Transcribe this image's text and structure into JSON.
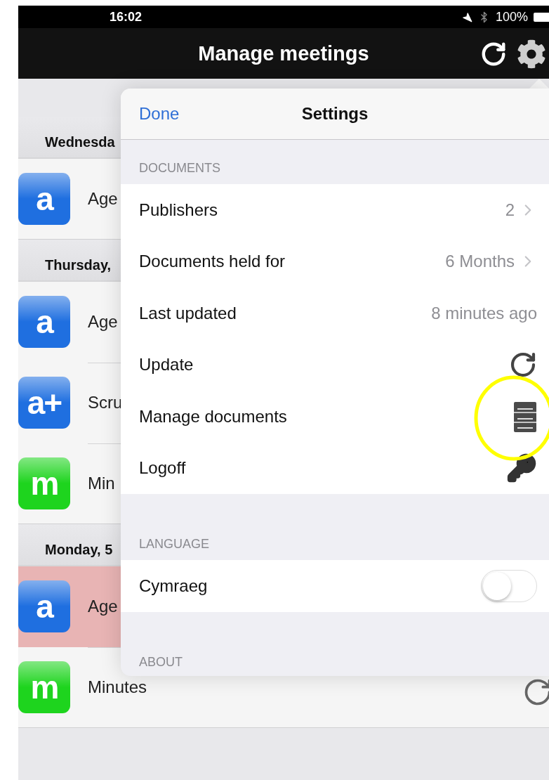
{
  "status_bar": {
    "time": "16:02",
    "battery": "100%"
  },
  "nav_bar": {
    "title": "Manage meetings"
  },
  "meetings": [
    {
      "date": "Wednesda",
      "items": [
        {
          "badge": "a",
          "color": "#1f6fe0",
          "title": "Age",
          "highlighted": false
        }
      ]
    },
    {
      "date": "Thursday,",
      "items": [
        {
          "badge": "a",
          "color": "#1f6fe0",
          "title": "Age",
          "highlighted": false
        },
        {
          "badge": "a+",
          "color": "#1f6fe0",
          "title": "Scru",
          "highlighted": false
        },
        {
          "badge": "m",
          "color": "#1ed41e",
          "title": "Min",
          "highlighted": false
        }
      ]
    },
    {
      "date": "Monday, 5",
      "items": [
        {
          "badge": "a",
          "color": "#1f6fe0",
          "title": "Age",
          "highlighted": true
        },
        {
          "badge": "m",
          "color": "#1ed41e",
          "title": "Minutes",
          "highlighted": false
        }
      ]
    }
  ],
  "settings": {
    "done": "Done",
    "title": "Settings",
    "sections": [
      {
        "header": "DOCUMENTS",
        "rows": [
          {
            "kind": "value",
            "label": "Publishers",
            "value": "2",
            "chevron": true
          },
          {
            "kind": "value",
            "label": "Documents held for",
            "value": "6 Months",
            "chevron": true
          },
          {
            "kind": "value",
            "label": "Last updated",
            "value": "8 minutes ago",
            "chevron": false
          },
          {
            "kind": "update",
            "label": "Update"
          },
          {
            "kind": "manage",
            "label": "Manage documents"
          },
          {
            "kind": "logoff",
            "label": "Logoff"
          }
        ]
      },
      {
        "header": "LANGUAGE",
        "rows": [
          {
            "kind": "toggle",
            "label": "Cymraeg",
            "on": false
          }
        ]
      },
      {
        "header": "ABOUT"
      }
    ]
  }
}
